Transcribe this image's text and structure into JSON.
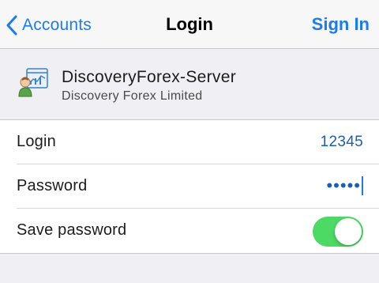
{
  "nav": {
    "back_label": "Accounts",
    "title": "Login",
    "action_label": "Sign In"
  },
  "server": {
    "name": "DiscoveryForex-Server",
    "company": "Discovery Forex Limited",
    "icon": "server-account-icon"
  },
  "form": {
    "login": {
      "label": "Login",
      "value": "12345"
    },
    "password": {
      "label": "Password",
      "masked_value": "•••••"
    },
    "save_password": {
      "label": "Save password",
      "enabled": true
    }
  },
  "colors": {
    "accent": "#1a7cf0",
    "value_text": "#1a5fb4",
    "toggle_on": "#4cd964",
    "background": "#efeff4"
  }
}
